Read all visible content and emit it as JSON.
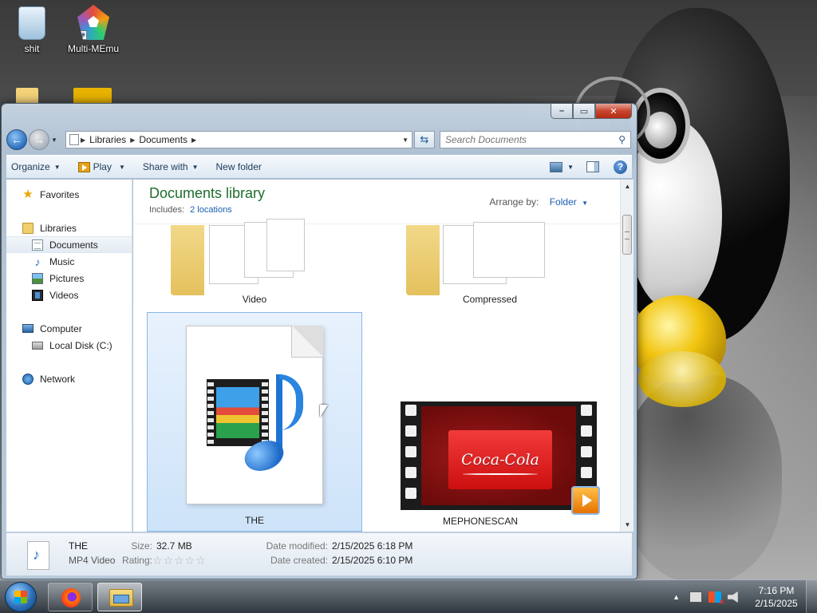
{
  "desktop": {
    "icons": [
      {
        "label": "shit",
        "icon": "recycle-bin-icon"
      },
      {
        "label": "Multi-MEmu",
        "icon": "multi-memu-icon"
      }
    ]
  },
  "window": {
    "caption_buttons": {
      "minimize": "–",
      "maximize": "▭",
      "close": "✕"
    },
    "address": {
      "segments": [
        "Libraries",
        "Documents"
      ],
      "separator": "▶",
      "dropdown": "▼"
    },
    "search": {
      "placeholder": "Search Documents"
    },
    "toolbar": {
      "organize": "Organize",
      "play": "Play",
      "share_with": "Share with",
      "new_folder": "New folder",
      "dropdown_arrow": "▼",
      "help": "?"
    },
    "nav_pane": {
      "favorites": "Favorites",
      "libraries": "Libraries",
      "documents": "Documents",
      "music": "Music",
      "pictures": "Pictures",
      "videos": "Videos",
      "computer": "Computer",
      "local_disk": "Local Disk (C:)",
      "network": "Network"
    },
    "library": {
      "title": "Documents library",
      "includes_label": "Includes:",
      "includes_link": "2 locations",
      "arrange_label": "Arrange by:",
      "arrange_value": "Folder",
      "arrow": "▼"
    },
    "items": [
      {
        "name": "Video",
        "type": "folder"
      },
      {
        "name": "Compressed",
        "type": "folder"
      },
      {
        "name": "THE",
        "type": "mp4-file",
        "selected": true
      },
      {
        "name": "MEPHONESCAN",
        "type": "video-thumbnail",
        "thumb_text": "Coca-Cola"
      }
    ],
    "scrollbar": {
      "up": "▲",
      "down": "▼"
    },
    "details": {
      "name": "THE",
      "type": "MP4 Video",
      "size_label": "Size:",
      "size_value": "32.7 MB",
      "rating_label": "Rating:",
      "rating_value": 0,
      "rating_stars": "☆☆☆☆☆",
      "modified_label": "Date modified:",
      "modified_value": "2/15/2025 6:18 PM",
      "created_label": "Date created:",
      "created_value": "2/15/2025 6:10 PM"
    }
  },
  "taskbar": {
    "pinned": [
      {
        "name": "firefox",
        "icon": "firefox-icon"
      },
      {
        "name": "windows-explorer",
        "icon": "explorer-icon",
        "active": true
      }
    ],
    "tray": {
      "expand": "▲",
      "time": "7:16 PM",
      "date": "2/15/2025"
    }
  },
  "colors": {
    "library_title": "#1e6e2c",
    "link": "#1a5fb4",
    "selection": "#cde3f9",
    "close_button": "#c9452f"
  }
}
